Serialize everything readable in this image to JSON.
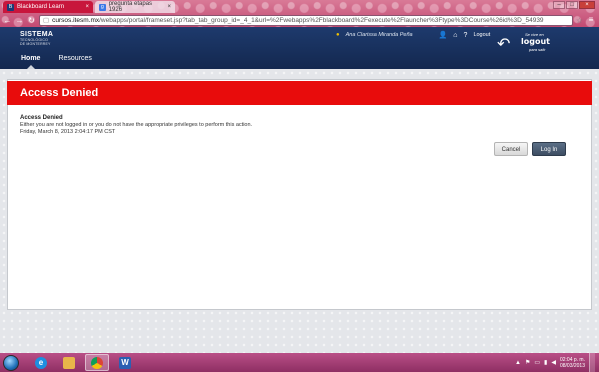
{
  "browser": {
    "tabs": [
      {
        "label": "Blackboard Learn",
        "icon": "blackboard-favicon",
        "active": true
      },
      {
        "label": "pregunta etapas 1926",
        "icon": "google-favicon",
        "active": false
      }
    ],
    "url_host": "cursos.itesm.mx",
    "url_path": "/webapps/portal/frameset.jsp?tab_tab_group_id=_4_1&url=%2Fwebapps%2Fblackboard%2Fexecute%2Flauncher%3Ftype%3DCourse%26id%3D_54939"
  },
  "header": {
    "logo_line1": "SISTEMA",
    "logo_line2": "TECNOLÓGICO",
    "logo_line3": "DE MONTERREY",
    "user_name": "Ana Clarissa Miranda Peña",
    "logout_link": "Logout",
    "logout_brand_top": "Se vive en",
    "logout_brand_main": "logout",
    "logout_brand_bottom": "para salir",
    "nav": [
      {
        "label": "Home",
        "active": true
      },
      {
        "label": "Resources",
        "active": false
      }
    ]
  },
  "content": {
    "banner_title": "Access Denied",
    "message_title": "Access Denied",
    "message_body": "Either you are not logged in or you do not have the appropriate privileges to perform this action.",
    "message_date": "Friday, March 8, 2013 2:04:17 PM CST",
    "cancel_label": "Cancel",
    "login_label": "Log In"
  },
  "taskbar": {
    "apps": [
      "internet-explorer",
      "windows-explorer",
      "google-chrome",
      "microsoft-word"
    ],
    "clock_time": "02:04 p. m.",
    "clock_date": "08/03/2013"
  },
  "colors": {
    "header_bg": "#1e3a6d",
    "banner_red": "#e80c0c",
    "login_btn": "#4a5a70"
  }
}
